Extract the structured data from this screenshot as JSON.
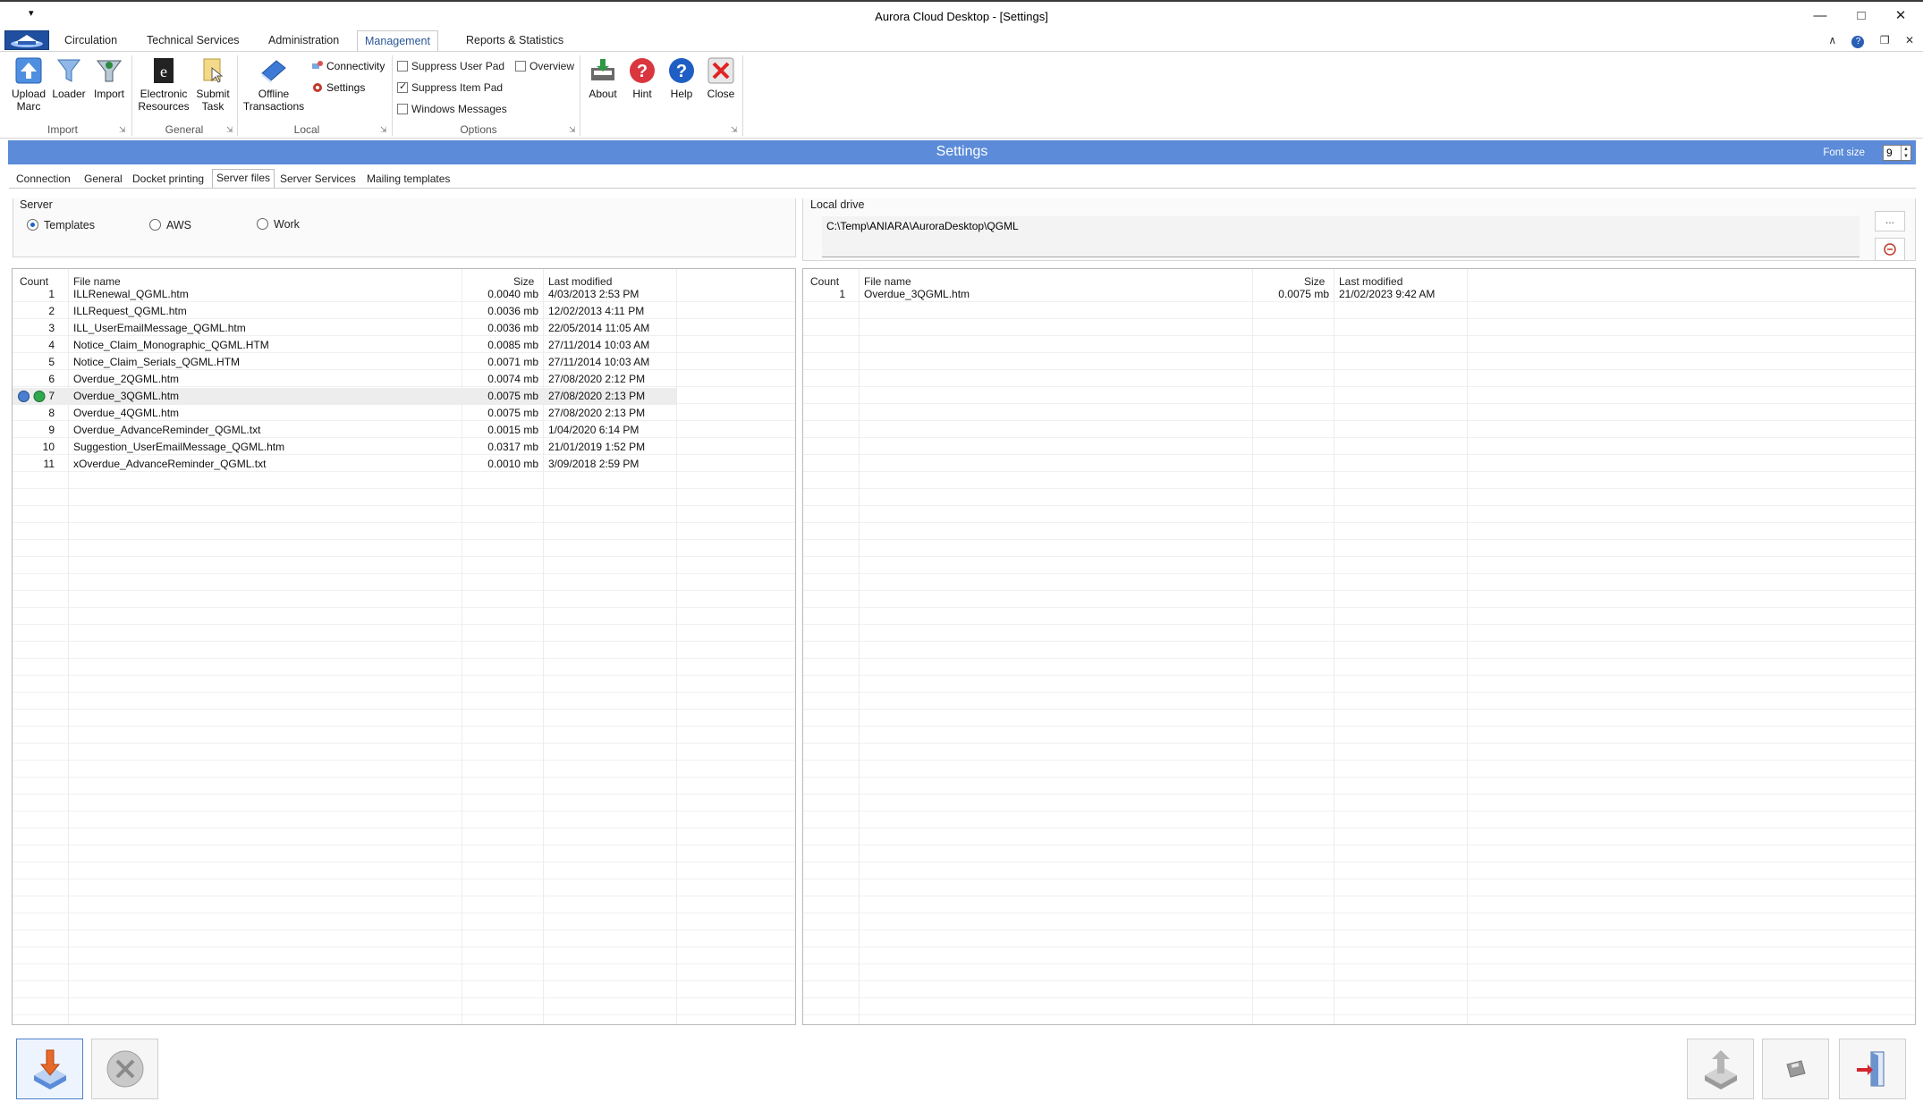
{
  "window": {
    "title": "Aurora Cloud Desktop - [Settings]",
    "quick_access": "▾",
    "minimize": "—",
    "maximize": "□",
    "close": "✕"
  },
  "ribbon_tabs": [
    {
      "label": "Circulation"
    },
    {
      "label": "Technical Services"
    },
    {
      "label": "Administration"
    },
    {
      "label": "Management",
      "active": true
    },
    {
      "label": "Reports & Statistics"
    }
  ],
  "ribbon_right": {
    "collapse": "∧",
    "help": "?",
    "restore": "❐",
    "close": "✕"
  },
  "ribbon": {
    "import": {
      "name": "Import",
      "upload_marc": "Upload Marc",
      "loader": "Loader",
      "import": "Import"
    },
    "general": {
      "name": "General",
      "electronic_resources": "Electronic Resources",
      "submit_task": "Submit Task"
    },
    "local": {
      "name": "Local",
      "offline_transactions": "Offline Transactions",
      "connectivity": "Connectivity",
      "settings": "Settings"
    },
    "options": {
      "name": "Options",
      "suppress_user_pad": {
        "label": "Suppress User Pad",
        "checked": false
      },
      "suppress_item_pad": {
        "label": "Suppress Item Pad",
        "checked": true
      },
      "windows_messages": {
        "label": "Windows Messages",
        "checked": false
      },
      "overview": {
        "label": "Overview",
        "checked": false
      }
    },
    "help": {
      "about": "About",
      "hint": "Hint",
      "help": "Help",
      "close": "Close"
    },
    "launcher": "⇲"
  },
  "settings": {
    "title": "Settings",
    "font_size_label": "Font size",
    "font_size_value": "9",
    "tabs": [
      {
        "label": "Connection"
      },
      {
        "label": "General"
      },
      {
        "label": "Docket printing"
      },
      {
        "label": "Server files",
        "active": true
      },
      {
        "label": "Server Services"
      },
      {
        "label": "Mailing templates"
      }
    ]
  },
  "server": {
    "label": "Server",
    "options": [
      {
        "label": "Templates",
        "selected": true
      },
      {
        "label": "AWS",
        "selected": false
      },
      {
        "label": "Work",
        "selected": false
      }
    ]
  },
  "local_drive": {
    "label": "Local drive",
    "path": "C:\\Temp\\ANIARA\\AuroraDesktop\\QGML",
    "browse_label": "..."
  },
  "server_grid": {
    "columns": {
      "count": "Count",
      "name": "File name",
      "size": "Size",
      "modified": "Last modified"
    },
    "rows": [
      {
        "count": "1",
        "name": "ILLRenewal_QGML.htm",
        "size": "0.0040 mb",
        "modified": "4/03/2013 2:53 PM"
      },
      {
        "count": "2",
        "name": "ILLRequest_QGML.htm",
        "size": "0.0036 mb",
        "modified": "12/02/2013 4:11 PM"
      },
      {
        "count": "3",
        "name": "ILL_UserEmailMessage_QGML.htm",
        "size": "0.0036 mb",
        "modified": "22/05/2014 11:05 AM"
      },
      {
        "count": "4",
        "name": "Notice_Claim_Monographic_QGML.HTM",
        "size": "0.0085 mb",
        "modified": "27/11/2014 10:03 AM"
      },
      {
        "count": "5",
        "name": "Notice_Claim_Serials_QGML.HTM",
        "size": "0.0071 mb",
        "modified": "27/11/2014 10:03 AM"
      },
      {
        "count": "6",
        "name": "Overdue_2QGML.htm",
        "size": "0.0074 mb",
        "modified": "27/08/2020 2:12 PM"
      },
      {
        "count": "7",
        "name": "Overdue_3QGML.htm",
        "size": "0.0075 mb",
        "modified": "27/08/2020 2:13 PM",
        "selected": true
      },
      {
        "count": "8",
        "name": "Overdue_4QGML.htm",
        "size": "0.0075 mb",
        "modified": "27/08/2020 2:13 PM"
      },
      {
        "count": "9",
        "name": "Overdue_AdvanceReminder_QGML.txt",
        "size": "0.0015 mb",
        "modified": "1/04/2020 6:14 PM"
      },
      {
        "count": "10",
        "name": "Suggestion_UserEmailMessage_QGML.htm",
        "size": "0.0317 mb",
        "modified": "21/01/2019 1:52 PM"
      },
      {
        "count": "11",
        "name": "xOverdue_AdvanceReminder_QGML.txt",
        "size": "0.0010 mb",
        "modified": "3/09/2018 2:59 PM"
      }
    ]
  },
  "local_grid": {
    "columns": {
      "count": "Count",
      "name": "File name",
      "size": "Size",
      "modified": "Last modified"
    },
    "rows": [
      {
        "count": "1",
        "name": "Overdue_3QGML.htm",
        "size": "0.0075 mb",
        "modified": "21/02/2023 9:42 AM"
      }
    ]
  },
  "colors": {
    "header_blue": "#5b8bd9",
    "accent": "#2b5797",
    "selection": "#ededed"
  }
}
